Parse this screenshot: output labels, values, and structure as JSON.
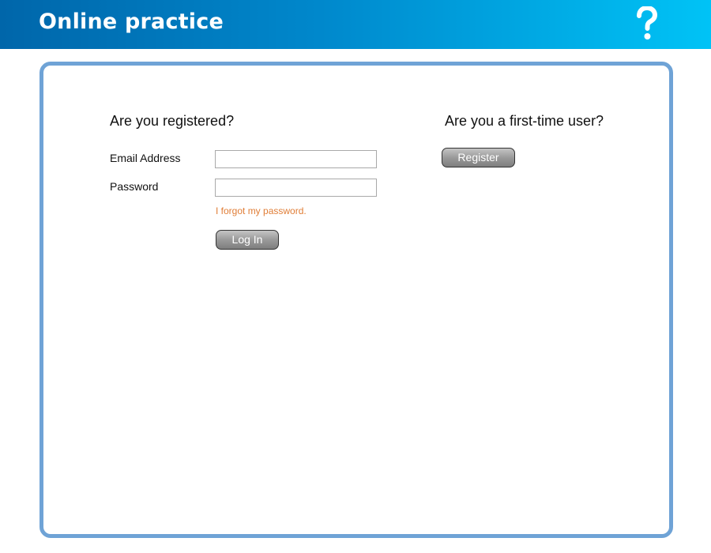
{
  "header": {
    "title": "Online practice",
    "help_icon": "question-mark-icon"
  },
  "login": {
    "heading": "Are you registered?",
    "email_label": "Email Address",
    "email_value": "",
    "password_label": "Password",
    "password_value": "",
    "forgot_link": "I forgot my password.",
    "login_button": "Log In"
  },
  "register": {
    "heading": "Are you a first-time user?",
    "register_button": "Register"
  },
  "colors": {
    "header_gradient_start": "#0066aa",
    "header_gradient_end": "#00c3f6",
    "panel_border": "#6fa3d6",
    "link": "#e07d36"
  }
}
